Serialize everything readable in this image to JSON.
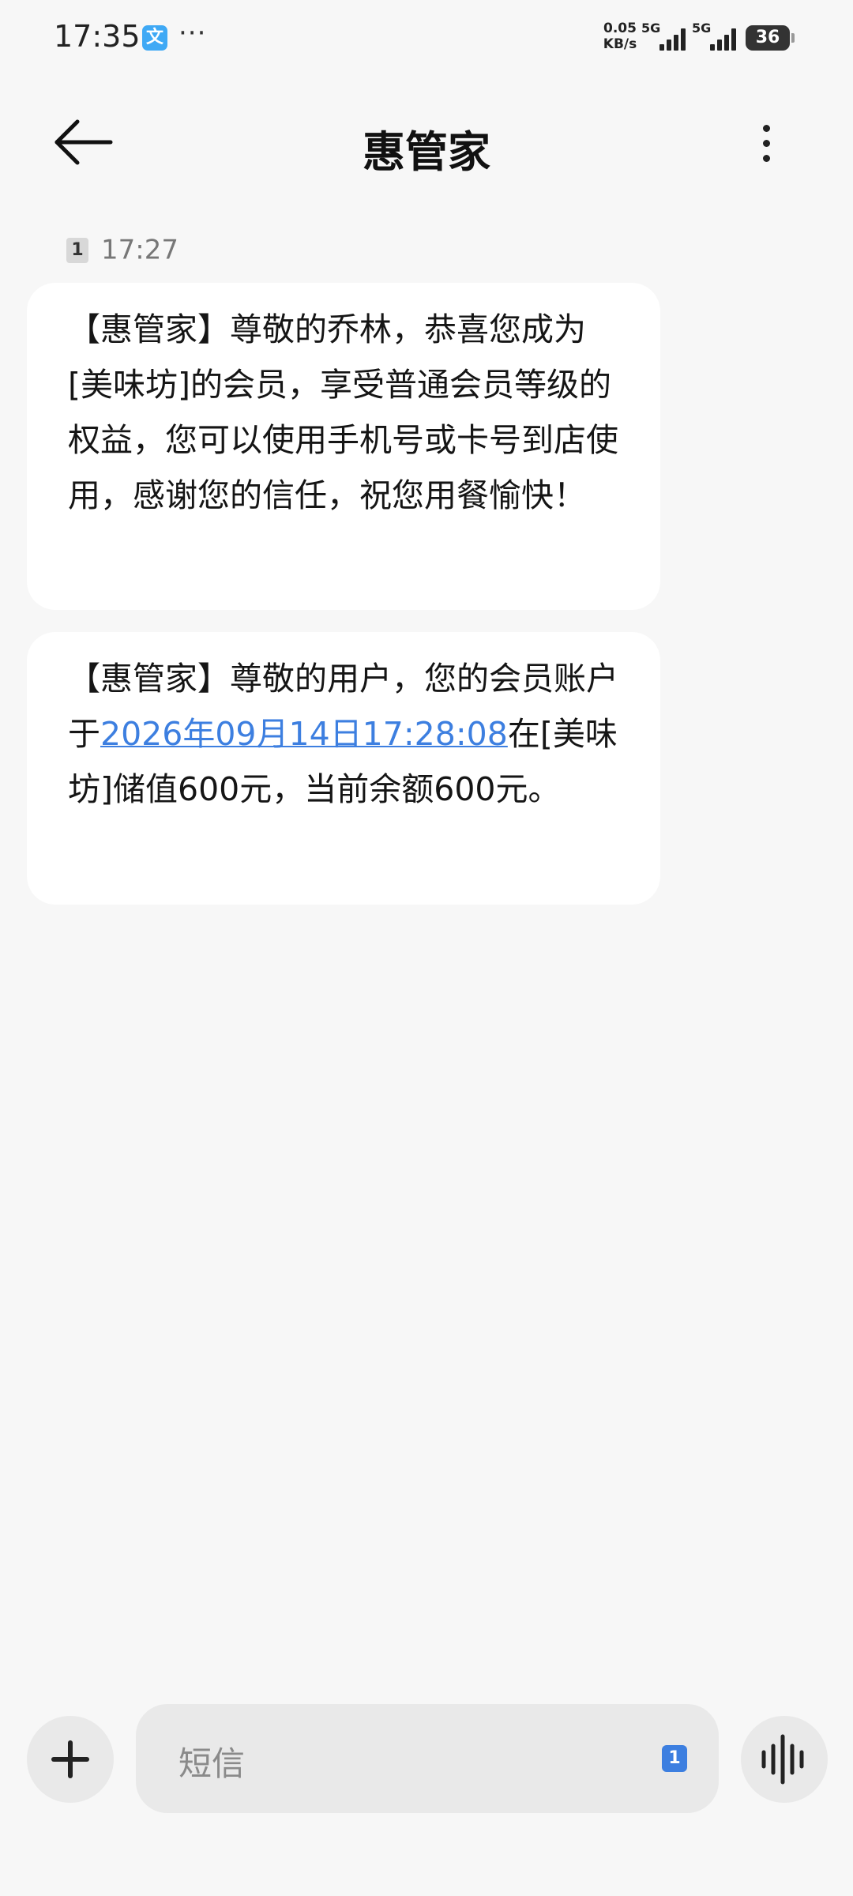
{
  "status_bar": {
    "time": "17:35",
    "app_icon_glyph": "文",
    "more": "···",
    "net_speed_value": "0.05",
    "net_speed_unit": "KB/s",
    "signal_1": "5G",
    "signal_2": "5G",
    "battery": "36"
  },
  "header": {
    "title": "惠管家",
    "back_icon": "arrow-left-icon",
    "menu_icon": "more-vertical-icon"
  },
  "conversation": {
    "sim_badge": "1",
    "timestamp": "17:27",
    "messages": [
      {
        "text": "【惠管家】尊敬的乔林，恭喜您成为[美味坊]的会员，享受普通会员等级的权益，您可以使用手机号或卡号到店使用，感谢您的信任，祝您用餐愉快！"
      },
      {
        "text_before": "【惠管家】尊敬的用户，您的会员账户于",
        "link": "2026年09月14日17:28:08",
        "text_after": "在[美味坊]储值600元，当前余额600元。"
      }
    ]
  },
  "composer": {
    "add_icon": "plus-icon",
    "placeholder": "短信",
    "sim_indicator": "1",
    "voice_icon": "voice-wave-icon"
  }
}
